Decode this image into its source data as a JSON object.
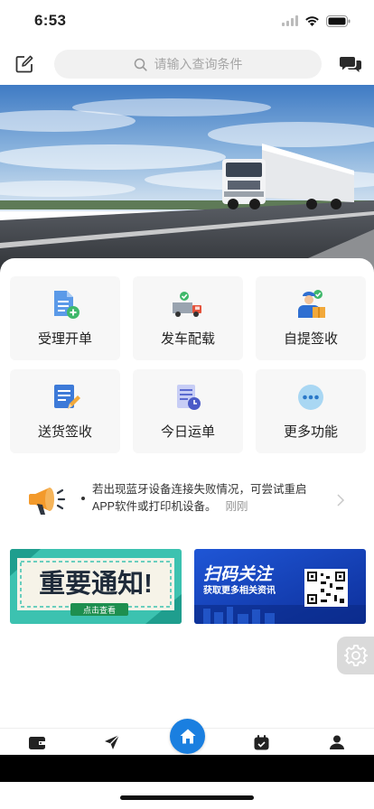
{
  "status_bar": {
    "time": "6:53"
  },
  "header": {
    "search_placeholder": "请输入查询条件",
    "edit_icon": "edit-icon",
    "message_icon": "chat-bubbles-icon"
  },
  "hero": {
    "image": "truck-on-highway-photo"
  },
  "features": [
    {
      "label": "受理开单",
      "icon": "document-add-icon"
    },
    {
      "label": "发车配载",
      "icon": "truck-check-icon"
    },
    {
      "label": "自提签收",
      "icon": "worker-package-icon"
    },
    {
      "label": "送货签收",
      "icon": "document-sign-icon"
    },
    {
      "label": "今日运单",
      "icon": "document-clock-icon"
    },
    {
      "label": "更多功能",
      "icon": "more-dots-icon"
    }
  ],
  "notice": {
    "text": "若出现蓝牙设备连接失败情况，可尝试重启APP软件或打印机设备。",
    "time": "刚刚"
  },
  "banners": {
    "left": {
      "title": "重要通知!",
      "button": "点击查看"
    },
    "right": {
      "title": "扫码关注",
      "subtitle": "获取更多相关资讯"
    }
  },
  "tabs": [
    {
      "name": "wallet",
      "icon": "wallet-icon"
    },
    {
      "name": "send",
      "icon": "paper-plane-icon"
    },
    {
      "name": "home",
      "icon": "home-icon"
    },
    {
      "name": "schedule",
      "icon": "calendar-check-icon"
    },
    {
      "name": "profile",
      "icon": "user-icon"
    }
  ],
  "colors": {
    "accent": "#1a7fe0",
    "tile_bg": "#f7f7f7",
    "notice_orange": "#f39a2b"
  }
}
